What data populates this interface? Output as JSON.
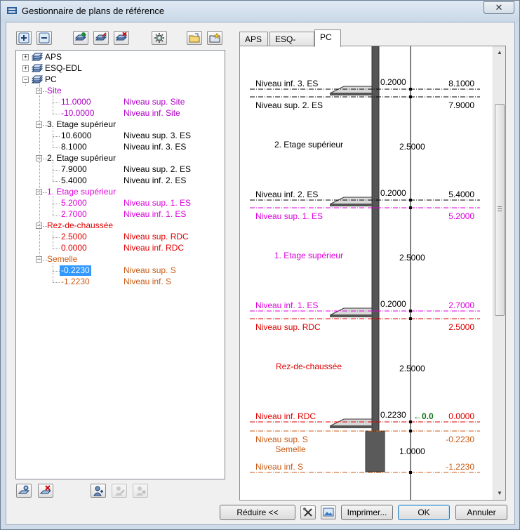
{
  "window": {
    "title": "Gestionnaire de plans de référence",
    "close_glyph": "✕"
  },
  "colors": {
    "black": "#000000",
    "violet": "#b000c8",
    "magenta": "#dd00dd",
    "red": "#e00000",
    "orange": "#c85a14",
    "green": "#0b6e0b",
    "selection": "#3399ff"
  },
  "toolbar_icons": [
    "expand-all-icon",
    "collapse-all-icon",
    "add-plan-icon",
    "edit-plan-icon",
    "delete-plan-icon",
    "settings-icon",
    "open-file-icon",
    "favorites-icon"
  ],
  "tree": {
    "roots": [
      {
        "label": "APS",
        "expanded": false
      },
      {
        "label": "ESQ-EDL",
        "expanded": false
      },
      {
        "label": "PC",
        "expanded": true
      }
    ],
    "groups": [
      {
        "label": "Site",
        "color": "violet",
        "levels": [
          {
            "value": "11.0000",
            "name": "Niveau sup. Site"
          },
          {
            "value": "-10.0000",
            "name": "Niveau inf. Site"
          }
        ]
      },
      {
        "label": "3. Etage supérieur",
        "color": "black",
        "levels": [
          {
            "value": "10.6000",
            "name": "Niveau sup. 3. ES"
          },
          {
            "value": "8.1000",
            "name": "Niveau inf. 3. ES"
          }
        ]
      },
      {
        "label": "2. Etage supérieur",
        "color": "black",
        "levels": [
          {
            "value": "7.9000",
            "name": "Niveau sup. 2. ES"
          },
          {
            "value": "5.4000",
            "name": "Niveau inf. 2. ES"
          }
        ]
      },
      {
        "label": "1. Etage supérieur",
        "color": "magenta",
        "levels": [
          {
            "value": "5.2000",
            "name": "Niveau sup. 1. ES"
          },
          {
            "value": "2.7000",
            "name": "Niveau inf. 1. ES"
          }
        ]
      },
      {
        "label": "Rez-de-chaussée",
        "color": "red",
        "levels": [
          {
            "value": "2.5000",
            "name": "Niveau sup. RDC"
          },
          {
            "value": "0.0000",
            "name": "Niveau inf. RDC"
          }
        ]
      },
      {
        "label": "Semelle",
        "color": "orange",
        "levels": [
          {
            "value": "-0.2230",
            "name": "Niveau sup. S",
            "selected": true
          },
          {
            "value": "-1.2230",
            "name": "Niveau inf. S"
          }
        ]
      }
    ]
  },
  "tabs": [
    {
      "label": "APS"
    },
    {
      "label": "ESQ-EDL"
    },
    {
      "label": "PC",
      "active": true
    }
  ],
  "drawing": {
    "levels": [
      {
        "name": "Niveau inf. 3. ES",
        "value": "8.1000",
        "color": "black",
        "slab": "0.2000"
      },
      {
        "name": "Niveau sup. 2. ES",
        "value": "7.9000",
        "color": "black"
      },
      {
        "name": "Niveau inf. 2. ES",
        "value": "5.4000",
        "color": "black",
        "slab": "0.2000"
      },
      {
        "name": "Niveau sup. 1. ES",
        "value": "5.2000",
        "color": "magenta"
      },
      {
        "name": "Niveau inf. 1. ES",
        "value": "2.7000",
        "color": "magenta",
        "slab": "0.2000"
      },
      {
        "name": "Niveau sup. RDC",
        "value": "2.5000",
        "color": "red"
      },
      {
        "name": "Niveau inf. RDC",
        "value": "0.0000",
        "color": "red",
        "slab": "0.2230"
      },
      {
        "name": "Niveau sup. S",
        "value": "-0.2230",
        "color": "orange"
      },
      {
        "name": "Niveau inf. S",
        "value": "-1.2230",
        "color": "orange"
      }
    ],
    "stories": [
      {
        "label": "2. Etage supérieur",
        "height": "2.5000",
        "color": "black"
      },
      {
        "label": "1. Etage supérieur",
        "height": "2.5000",
        "color": "magenta"
      },
      {
        "label": "Rez-de-chaussée",
        "height": "2.5000",
        "color": "red"
      },
      {
        "label": "Semelle",
        "height": "1.0000",
        "color": "orange"
      }
    ],
    "zero_marker": "←0.0"
  },
  "buttons": {
    "reduce": "Réduire <<",
    "print": "Imprimer...",
    "ok": "OK",
    "cancel": "Annuler"
  }
}
